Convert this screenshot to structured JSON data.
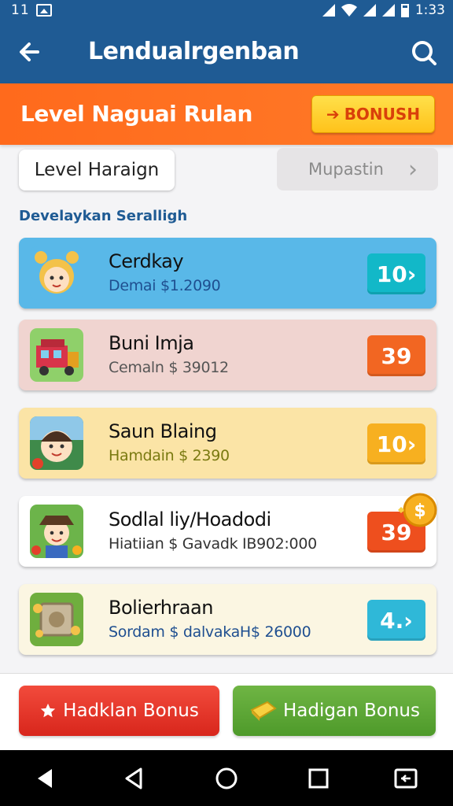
{
  "status_bar": {
    "left_text": "11",
    "time": "1:33"
  },
  "app_bar": {
    "title": "Lendualrgenban",
    "back_icon": "arrow-left-icon",
    "search_icon": "search-icon"
  },
  "banner": {
    "title": "Level Naguai Rulan",
    "bonus_label": "BONUSH",
    "bonus_arrow": "➔"
  },
  "segments": {
    "left_label": "Level Haraign",
    "right_label": "Mupastin",
    "right_chevron": "›"
  },
  "section_title": "Develaykan Seralligh",
  "items": [
    {
      "name": "Cerdkay",
      "subtitle": "Demai $1.2090",
      "value": "10",
      "arrow": "›",
      "bg": "#59b8e8",
      "pill": "#12b8c8",
      "sub_color": "#1f4f90",
      "icon": "girl-avatar-icon"
    },
    {
      "name": "Buni Imja",
      "subtitle": "Cemaln $ 39012",
      "value": "39",
      "arrow": "",
      "bg": "#f0d4d0",
      "pill": "#f26622",
      "sub_color": "#555555",
      "icon": "toy-truck-icon"
    },
    {
      "name": "Saun Blaing",
      "subtitle": "Hamdain $ 2390",
      "value": "10",
      "arrow": "›",
      "bg": "#fbe4a6",
      "pill": "#f7b020",
      "sub_color": "#7a7a10",
      "icon": "boy-avatar-icon"
    },
    {
      "name": "Sodlal liy/Hoadodi",
      "subtitle": "Hiatiian $ Gavadk IB902:000",
      "value": "39",
      "arrow": "",
      "bg": "#ffffff",
      "pill": "#ee4f1e",
      "sub_color": "#333333",
      "icon": "farmer-avatar-icon"
    },
    {
      "name": "Bolierhraan",
      "subtitle": "Sordam $ dalvakaH$ 26000",
      "value": "4.",
      "arrow": "›",
      "bg": "#fbf6e2",
      "pill": "#2fb8d8",
      "sub_color": "#1f4f90",
      "icon": "treasure-chest-icon"
    }
  ],
  "bottom": {
    "left_button": "Hadklan Bonus",
    "left_icon": "star-icon",
    "right_button": "Hadigan Bonus",
    "right_icon": "gold-bar-icon"
  },
  "nav": [
    "back-triangle-icon",
    "back-outline-icon",
    "home-circle-icon",
    "recents-square-icon",
    "screen-cast-icon"
  ]
}
